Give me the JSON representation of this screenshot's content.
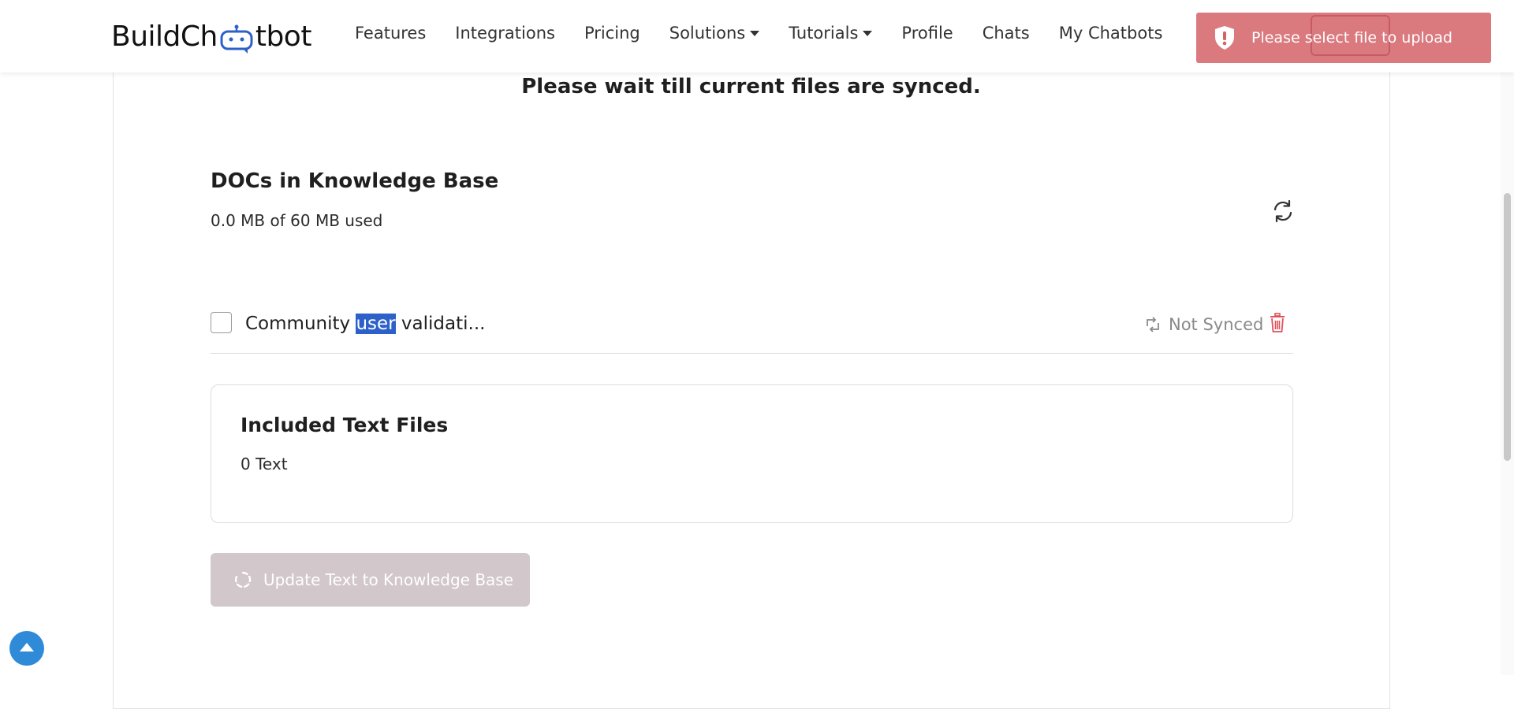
{
  "nav": {
    "logo_text_left": "BuildCh",
    "logo_text_right": "tbot",
    "links": [
      {
        "label": "Features",
        "dropdown": false
      },
      {
        "label": "Integrations",
        "dropdown": false
      },
      {
        "label": "Pricing",
        "dropdown": false
      },
      {
        "label": "Solutions",
        "dropdown": true
      },
      {
        "label": "Tutorials",
        "dropdown": true
      },
      {
        "label": "Profile",
        "dropdown": false
      },
      {
        "label": "Chats",
        "dropdown": false
      },
      {
        "label": "My Chatbots",
        "dropdown": false
      }
    ]
  },
  "toast": {
    "message": "Please select file to upload",
    "icon": "shield-exclamation-icon",
    "color": "#d36368"
  },
  "main": {
    "wait_message": "Please wait till current files are synced.",
    "docs_title": "DOCs in Knowledge Base",
    "usage": "0.0 MB of 60 MB used",
    "refresh_icon": "refresh-icon",
    "documents": [
      {
        "name_before": "Community ",
        "name_highlight": "user",
        "name_after": " validati...",
        "checked": false,
        "status": "Not Synced",
        "status_icon": "sync-icon",
        "delete_icon": "trash-icon"
      }
    ],
    "text_files": {
      "title": "Included Text Files",
      "count_label": "0 Text"
    },
    "update_button": {
      "label": "Update Text to Knowledge Base",
      "state": "loading"
    }
  },
  "colors": {
    "brand_blue": "#2d61c9",
    "danger": "#e0515d",
    "button_disabled": "#d2c7cb",
    "scroll_top": "#2f8bd8"
  }
}
